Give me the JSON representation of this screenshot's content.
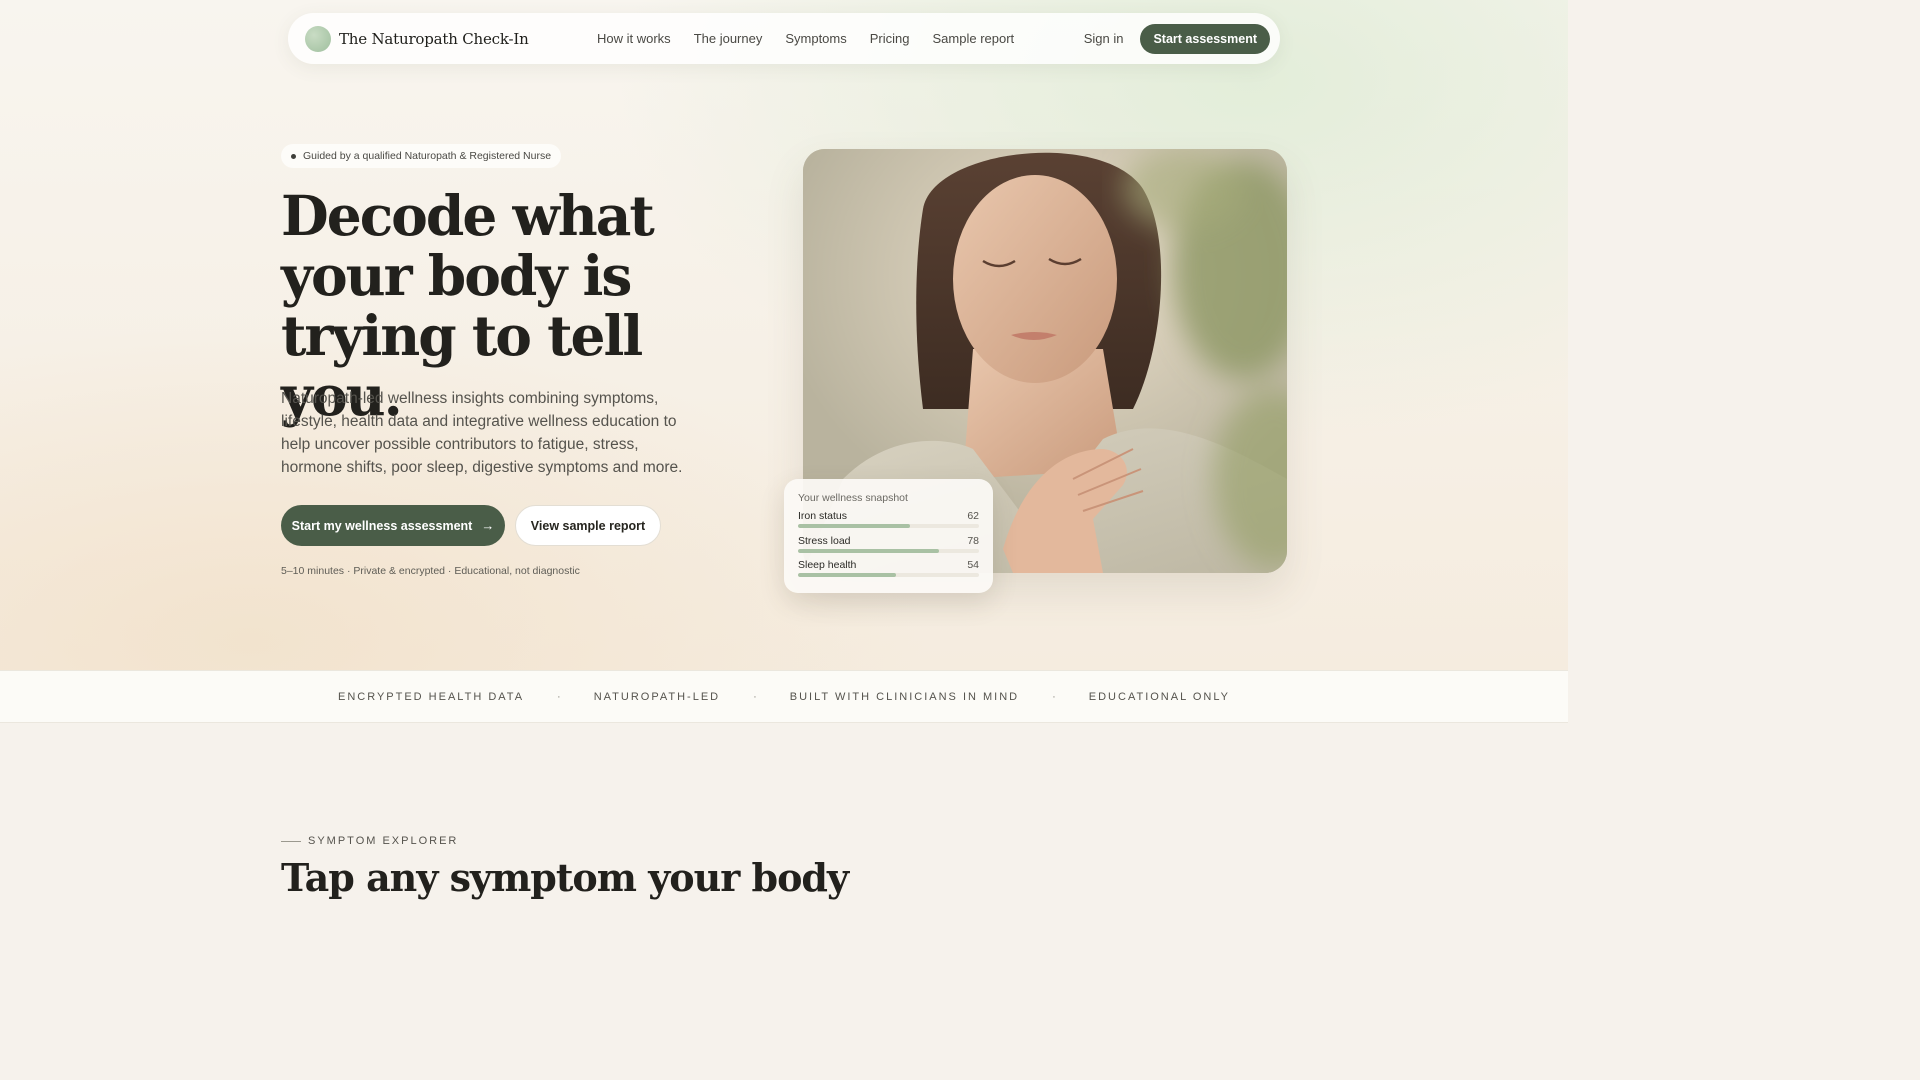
{
  "brand": {
    "name": "The Naturopath Check-In"
  },
  "nav": {
    "links": [
      "How it works",
      "The journey",
      "Symptoms",
      "Pricing",
      "Sample report"
    ],
    "sign_in": "Sign in",
    "cta": "Start assessment"
  },
  "hero": {
    "badge": "Guided by a qualified Naturopath & Registered Nurse",
    "headline_lines": [
      "Decode what",
      "your body is",
      "trying to tell you."
    ],
    "subtext": "Naturopath-led wellness insights combining symptoms, lifestyle, health data and integrative wellness education to help uncover possible contributors to fatigue, stress, hormone shifts, poor sleep, digestive symptoms and more.",
    "cta_primary": "Start my wellness assessment",
    "cta_primary_icon": "arrow-right-icon",
    "cta_secondary": "View sample report",
    "footnote": "5–10 minutes · Private & encrypted · Educational, not diagnostic"
  },
  "snapshot": {
    "title": "Your wellness snapshot",
    "metrics": [
      {
        "label": "Iron status",
        "value": 62
      },
      {
        "label": "Stress load",
        "value": 78
      },
      {
        "label": "Sleep health",
        "value": 54
      }
    ]
  },
  "trust": {
    "items": [
      "ENCRYPTED HEALTH DATA",
      "NATUROPATH-LED",
      "BUILT WITH CLINICIANS IN MIND",
      "EDUCATIONAL ONLY"
    ],
    "separator": "·"
  },
  "section": {
    "eyebrow": "SYMPTOM EXPLORER",
    "title": "Tap any symptom your body"
  },
  "colors": {
    "primary": "#4a5d48",
    "accent_bar": "#a9c1a4",
    "text": "#22211d"
  }
}
